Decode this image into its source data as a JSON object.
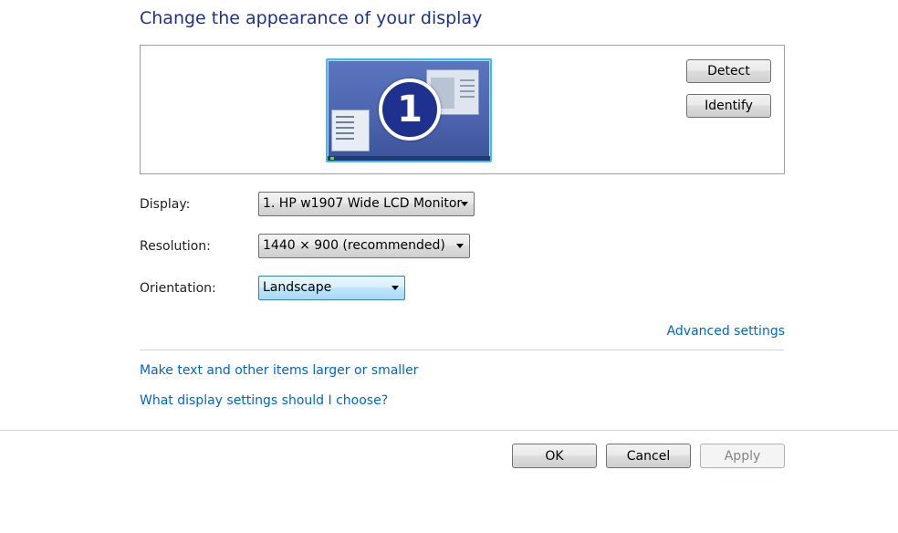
{
  "page": {
    "title": "Change the appearance of your display"
  },
  "preview": {
    "monitor_number": "1",
    "detect_label": "Detect",
    "identify_label": "Identify"
  },
  "settings": {
    "display_label": "Display:",
    "display_value": "1. HP w1907 Wide LCD Monitor",
    "resolution_label": "Resolution:",
    "resolution_value": "1440 × 900 (recommended)",
    "orientation_label": "Orientation:",
    "orientation_value": "Landscape"
  },
  "links": {
    "advanced": "Advanced settings",
    "text_size": "Make text and other items larger or smaller",
    "help": "What display settings should I choose?"
  },
  "footer": {
    "ok_label": "OK",
    "cancel_label": "Cancel",
    "apply_label": "Apply"
  },
  "colors": {
    "title": "#1e3287",
    "link": "#0066cc",
    "monitor_border": "#46b8ef",
    "monitor_badge": "#1f318e"
  },
  "icons": [
    "monitor-preview-icon",
    "dropdown-arrow-icon"
  ]
}
